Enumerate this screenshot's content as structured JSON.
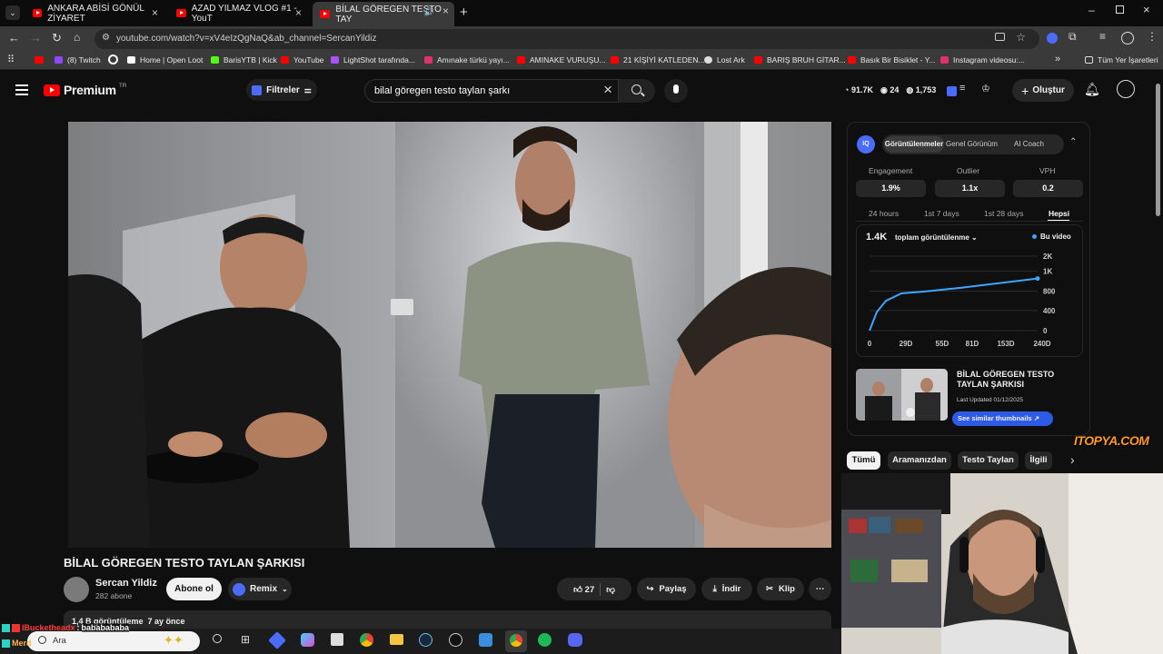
{
  "browser": {
    "tabs": [
      {
        "label": "ANKARA ABİSİ GÖNÜL ZİYARET"
      },
      {
        "label": "AZAD YILMAZ VLOG #1 - YouT"
      },
      {
        "label": "BİLAL GÖREGEN TESTO TAY"
      }
    ],
    "url": "youtube.com/watch?v=xV4eIzQgNaQ&ab_channel=SercanYildiz",
    "bookmarks": [
      {
        "label": "(8) Twitch",
        "color": "#9146ff"
      },
      {
        "label": "Home | Open Loot",
        "color": "#ffffff"
      },
      {
        "label": "BarisYTB | Kick",
        "color": "#53fc18"
      },
      {
        "label": "YouTube",
        "color": "#ff0000"
      },
      {
        "label": "LightShot tarafında...",
        "color": "#a855f7"
      },
      {
        "label": "Amınake türkü yayı...",
        "color": "#e1306c"
      },
      {
        "label": "AMINAKE VURUŞU...",
        "color": "#ff0000"
      },
      {
        "label": "21 KİŞİYİ KATLEDEN...",
        "color": "#ff0000"
      },
      {
        "label": "Lost Ark",
        "color": "#dddddd"
      },
      {
        "label": "BARIŞ BRUH GİTAR...",
        "color": "#ff0000"
      },
      {
        "label": "Basık Bir Bisiklet - Y...",
        "color": "#ff0000"
      },
      {
        "label": "Instagram videosu:...",
        "color": "#e1306c"
      }
    ],
    "bookmarks_all": "Tüm Yer İşaretleri"
  },
  "yt_header": {
    "logo": "Premium",
    "region": "TR",
    "filters": "Filtreler",
    "search_value": "bilal göregen testo taylan şarkı",
    "stats": [
      "91.7K",
      "24",
      "1,753"
    ],
    "create": "Oluştur"
  },
  "video": {
    "title": "BİLAL GÖREGEN TESTO TAYLAN ŞARKISI",
    "channel": "Sercan Yildiz",
    "subs": "282 abone",
    "subscribe": "Abone ol",
    "remix": "Remix",
    "likes": "27",
    "share": "Paylaş",
    "download": "İndir",
    "clip": "Klip",
    "views": "1,4 B görüntüleme  7 ay önce"
  },
  "vidiq": {
    "tabs": [
      "Görüntülenmeler",
      "Genel Görünüm",
      "AI Coach"
    ],
    "metrics": [
      {
        "label": "Engagement",
        "value": "1.9%"
      },
      {
        "label": "Outlier",
        "value": "1.1x"
      },
      {
        "label": "VPH",
        "value": "0.2"
      }
    ],
    "ranges": [
      "24 hours",
      "1st 7 days",
      "1st 28 days",
      "Hepsi"
    ],
    "total": "1.4K",
    "total_label": "toplam görüntülenme",
    "legend": "Bu video",
    "thumb_title": "BİLAL GÖREGEN TESTO TAYLAN ŞARKISI",
    "thumb_date": "Last Updated 01/12/2025",
    "similar": "See similar thumbnails"
  },
  "chips": [
    "Tümü",
    "Aramanızdan",
    "Testo Taylan",
    "İlgili"
  ],
  "watermark": "ITOPYA.COM",
  "chat": {
    "user": "IBucketheadx",
    "message": "bababababa",
    "user2": "Merd"
  },
  "taskbar": {
    "search": "Ara"
  },
  "chart_data": {
    "type": "line",
    "x": [
      "0",
      "29D",
      "55D",
      "81D",
      "153D",
      "240D"
    ],
    "series": [
      {
        "name": "Bu video",
        "values": [
          0,
          1000,
          1050,
          1100,
          1200,
          1400
        ]
      }
    ],
    "yticks": [
      "2K",
      "1K",
      "800",
      "400",
      "0"
    ],
    "ylim": [
      0,
      2000
    ],
    "color": "#3ea6ff"
  }
}
